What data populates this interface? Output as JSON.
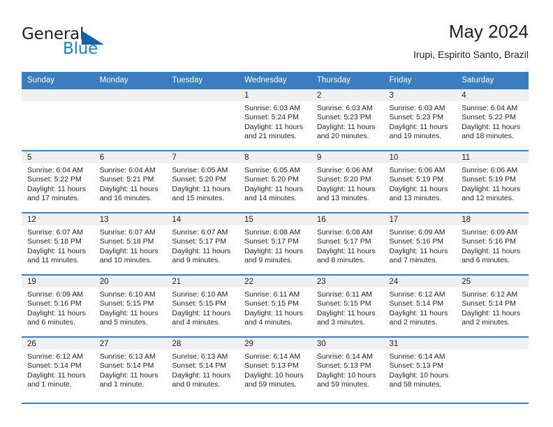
{
  "brand": {
    "word_general": "General",
    "word_blue": "Blue",
    "triangle_color": "#1263a8",
    "blue_color": "#1f7cc2"
  },
  "header": {
    "title": "May 2024",
    "location": "Irupi, Espirito Santo, Brazil"
  },
  "theme": {
    "header_bg": "#3a7ebf",
    "daynum_bg": "#f0f0f0",
    "text": "#231f20"
  },
  "weekday_headers": [
    "Sunday",
    "Monday",
    "Tuesday",
    "Wednesday",
    "Thursday",
    "Friday",
    "Saturday"
  ],
  "weeks": [
    [
      {
        "day": "",
        "sunrise": "",
        "sunset": "",
        "daylight_1": "",
        "daylight_2": ""
      },
      {
        "day": "",
        "sunrise": "",
        "sunset": "",
        "daylight_1": "",
        "daylight_2": ""
      },
      {
        "day": "",
        "sunrise": "",
        "sunset": "",
        "daylight_1": "",
        "daylight_2": ""
      },
      {
        "day": "1",
        "sunrise": "Sunrise: 6:03 AM",
        "sunset": "Sunset: 5:24 PM",
        "daylight_1": "Daylight: 11 hours",
        "daylight_2": "and 21 minutes."
      },
      {
        "day": "2",
        "sunrise": "Sunrise: 6:03 AM",
        "sunset": "Sunset: 5:23 PM",
        "daylight_1": "Daylight: 11 hours",
        "daylight_2": "and 20 minutes."
      },
      {
        "day": "3",
        "sunrise": "Sunrise: 6:03 AM",
        "sunset": "Sunset: 5:23 PM",
        "daylight_1": "Daylight: 11 hours",
        "daylight_2": "and 19 minutes."
      },
      {
        "day": "4",
        "sunrise": "Sunrise: 6:04 AM",
        "sunset": "Sunset: 5:22 PM",
        "daylight_1": "Daylight: 11 hours",
        "daylight_2": "and 18 minutes."
      }
    ],
    [
      {
        "day": "5",
        "sunrise": "Sunrise: 6:04 AM",
        "sunset": "Sunset: 5:22 PM",
        "daylight_1": "Daylight: 11 hours",
        "daylight_2": "and 17 minutes."
      },
      {
        "day": "6",
        "sunrise": "Sunrise: 6:04 AM",
        "sunset": "Sunset: 5:21 PM",
        "daylight_1": "Daylight: 11 hours",
        "daylight_2": "and 16 minutes."
      },
      {
        "day": "7",
        "sunrise": "Sunrise: 6:05 AM",
        "sunset": "Sunset: 5:20 PM",
        "daylight_1": "Daylight: 11 hours",
        "daylight_2": "and 15 minutes."
      },
      {
        "day": "8",
        "sunrise": "Sunrise: 6:05 AM",
        "sunset": "Sunset: 5:20 PM",
        "daylight_1": "Daylight: 11 hours",
        "daylight_2": "and 14 minutes."
      },
      {
        "day": "9",
        "sunrise": "Sunrise: 6:06 AM",
        "sunset": "Sunset: 5:20 PM",
        "daylight_1": "Daylight: 11 hours",
        "daylight_2": "and 13 minutes."
      },
      {
        "day": "10",
        "sunrise": "Sunrise: 6:06 AM",
        "sunset": "Sunset: 5:19 PM",
        "daylight_1": "Daylight: 11 hours",
        "daylight_2": "and 13 minutes."
      },
      {
        "day": "11",
        "sunrise": "Sunrise: 6:06 AM",
        "sunset": "Sunset: 5:19 PM",
        "daylight_1": "Daylight: 11 hours",
        "daylight_2": "and 12 minutes."
      }
    ],
    [
      {
        "day": "12",
        "sunrise": "Sunrise: 6:07 AM",
        "sunset": "Sunset: 5:18 PM",
        "daylight_1": "Daylight: 11 hours",
        "daylight_2": "and 11 minutes."
      },
      {
        "day": "13",
        "sunrise": "Sunrise: 6:07 AM",
        "sunset": "Sunset: 5:18 PM",
        "daylight_1": "Daylight: 11 hours",
        "daylight_2": "and 10 minutes."
      },
      {
        "day": "14",
        "sunrise": "Sunrise: 6:07 AM",
        "sunset": "Sunset: 5:17 PM",
        "daylight_1": "Daylight: 11 hours",
        "daylight_2": "and 9 minutes."
      },
      {
        "day": "15",
        "sunrise": "Sunrise: 6:08 AM",
        "sunset": "Sunset: 5:17 PM",
        "daylight_1": "Daylight: 11 hours",
        "daylight_2": "and 9 minutes."
      },
      {
        "day": "16",
        "sunrise": "Sunrise: 6:08 AM",
        "sunset": "Sunset: 5:17 PM",
        "daylight_1": "Daylight: 11 hours",
        "daylight_2": "and 8 minutes."
      },
      {
        "day": "17",
        "sunrise": "Sunrise: 6:09 AM",
        "sunset": "Sunset: 5:16 PM",
        "daylight_1": "Daylight: 11 hours",
        "daylight_2": "and 7 minutes."
      },
      {
        "day": "18",
        "sunrise": "Sunrise: 6:09 AM",
        "sunset": "Sunset: 5:16 PM",
        "daylight_1": "Daylight: 11 hours",
        "daylight_2": "and 6 minutes."
      }
    ],
    [
      {
        "day": "19",
        "sunrise": "Sunrise: 6:09 AM",
        "sunset": "Sunset: 5:16 PM",
        "daylight_1": "Daylight: 11 hours",
        "daylight_2": "and 6 minutes."
      },
      {
        "day": "20",
        "sunrise": "Sunrise: 6:10 AM",
        "sunset": "Sunset: 5:15 PM",
        "daylight_1": "Daylight: 11 hours",
        "daylight_2": "and 5 minutes."
      },
      {
        "day": "21",
        "sunrise": "Sunrise: 6:10 AM",
        "sunset": "Sunset: 5:15 PM",
        "daylight_1": "Daylight: 11 hours",
        "daylight_2": "and 4 minutes."
      },
      {
        "day": "22",
        "sunrise": "Sunrise: 6:11 AM",
        "sunset": "Sunset: 5:15 PM",
        "daylight_1": "Daylight: 11 hours",
        "daylight_2": "and 4 minutes."
      },
      {
        "day": "23",
        "sunrise": "Sunrise: 6:11 AM",
        "sunset": "Sunset: 5:15 PM",
        "daylight_1": "Daylight: 11 hours",
        "daylight_2": "and 3 minutes."
      },
      {
        "day": "24",
        "sunrise": "Sunrise: 6:12 AM",
        "sunset": "Sunset: 5:14 PM",
        "daylight_1": "Daylight: 11 hours",
        "daylight_2": "and 2 minutes."
      },
      {
        "day": "25",
        "sunrise": "Sunrise: 6:12 AM",
        "sunset": "Sunset: 5:14 PM",
        "daylight_1": "Daylight: 11 hours",
        "daylight_2": "and 2 minutes."
      }
    ],
    [
      {
        "day": "26",
        "sunrise": "Sunrise: 6:12 AM",
        "sunset": "Sunset: 5:14 PM",
        "daylight_1": "Daylight: 11 hours",
        "daylight_2": "and 1 minute."
      },
      {
        "day": "27",
        "sunrise": "Sunrise: 6:13 AM",
        "sunset": "Sunset: 5:14 PM",
        "daylight_1": "Daylight: 11 hours",
        "daylight_2": "and 1 minute."
      },
      {
        "day": "28",
        "sunrise": "Sunrise: 6:13 AM",
        "sunset": "Sunset: 5:14 PM",
        "daylight_1": "Daylight: 11 hours",
        "daylight_2": "and 0 minutes."
      },
      {
        "day": "29",
        "sunrise": "Sunrise: 6:14 AM",
        "sunset": "Sunset: 5:13 PM",
        "daylight_1": "Daylight: 10 hours",
        "daylight_2": "and 59 minutes."
      },
      {
        "day": "30",
        "sunrise": "Sunrise: 6:14 AM",
        "sunset": "Sunset: 5:13 PM",
        "daylight_1": "Daylight: 10 hours",
        "daylight_2": "and 59 minutes."
      },
      {
        "day": "31",
        "sunrise": "Sunrise: 6:14 AM",
        "sunset": "Sunset: 5:13 PM",
        "daylight_1": "Daylight: 10 hours",
        "daylight_2": "and 58 minutes."
      },
      {
        "day": "",
        "sunrise": "",
        "sunset": "",
        "daylight_1": "",
        "daylight_2": ""
      }
    ]
  ]
}
